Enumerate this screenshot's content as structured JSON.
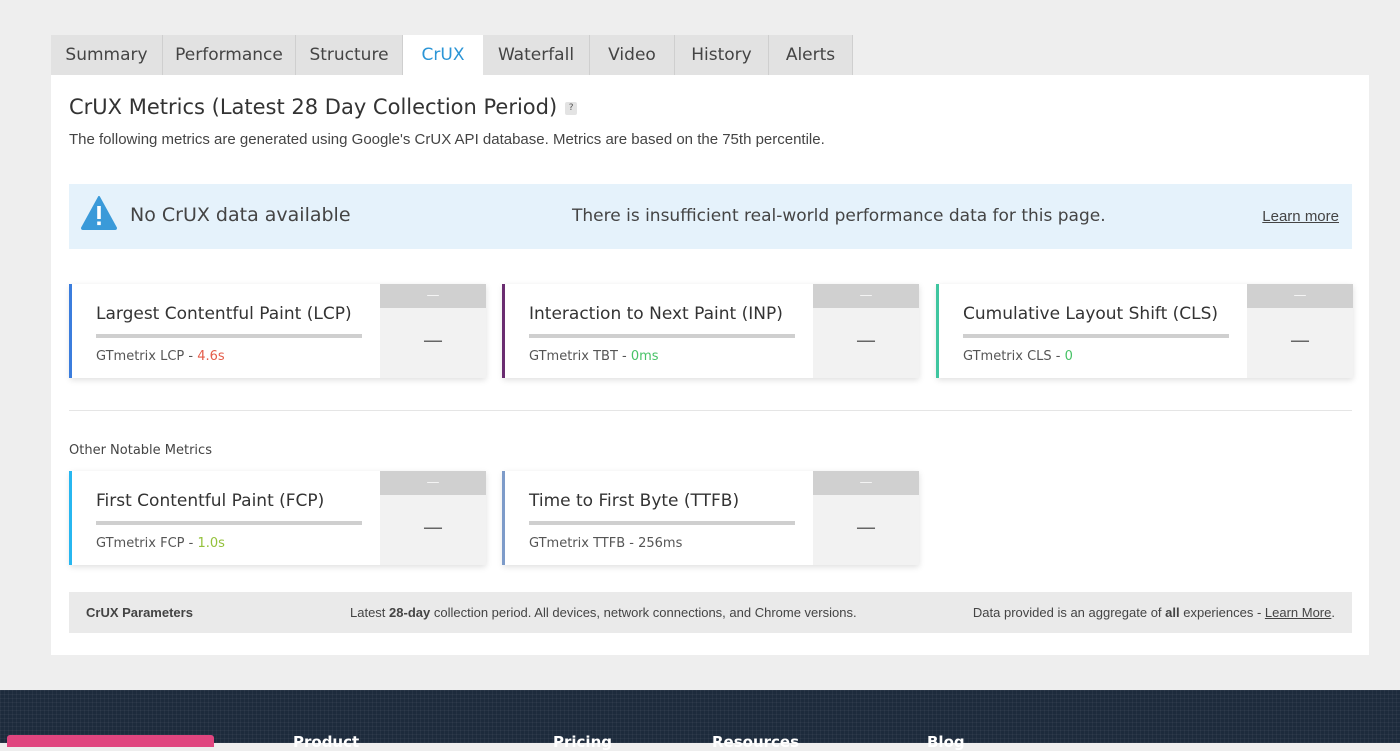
{
  "tabs": [
    "Summary",
    "Performance",
    "Structure",
    "CrUX",
    "Waterfall",
    "Video",
    "History",
    "Alerts"
  ],
  "active_tab": "CrUX",
  "title": "CrUX Metrics (Latest 28 Day Collection Period)",
  "help_icon_label": "?",
  "subtitle": "The following metrics are generated using Google's CrUX API database. Metrics are based on the 75th percentile.",
  "alert": {
    "icon": "warning-icon",
    "title": "No CrUX data available",
    "message": "There is insufficient real-world performance data for this page.",
    "link": "Learn more"
  },
  "cards": [
    {
      "name": "Largest Contentful Paint (LCP)",
      "gt_label": "GTmetrix LCP - ",
      "gt_value": "4.6s",
      "side_top": "—",
      "side_value": "—",
      "accent": "#3b7ddd",
      "value_color": "#e45c4a"
    },
    {
      "name": "Interaction to Next Paint (INP)",
      "gt_label": "GTmetrix TBT - ",
      "gt_value": "0ms",
      "side_top": "—",
      "side_value": "—",
      "accent": "#6a2c70",
      "value_color": "#47c266"
    },
    {
      "name": "Cumulative Layout Shift (CLS)",
      "gt_label": "GTmetrix CLS - ",
      "gt_value": "0",
      "side_top": "—",
      "side_value": "—",
      "accent": "#3fc6a0",
      "value_color": "#47c266"
    }
  ],
  "other_heading": "Other Notable Metrics",
  "other_cards": [
    {
      "name": "First Contentful Paint (FCP)",
      "gt_label": "GTmetrix FCP - ",
      "gt_value": "1.0s",
      "side_top": "—",
      "side_value": "—",
      "accent": "#27b7f0",
      "value_color": "#93c13a"
    },
    {
      "name": "Time to First Byte (TTFB)",
      "gt_label": "GTmetrix TTFB - ",
      "gt_value": "256ms",
      "side_top": "—",
      "side_value": "—",
      "accent": "#7d9bc9",
      "value_color": "#555555"
    }
  ],
  "params": {
    "label": "CrUX Parameters",
    "mid_prefix": "Latest ",
    "mid_bold": "28-day",
    "mid_suffix": " collection period. All devices, network connections, and Chrome versions.",
    "right_prefix": "Data provided is an aggregate of ",
    "right_bold": "all",
    "right_suffix": " experiences - ",
    "right_link": "Learn More",
    "right_end": "."
  },
  "footer": {
    "links": [
      "Product",
      "Pricing",
      "Resources",
      "Blog"
    ]
  }
}
